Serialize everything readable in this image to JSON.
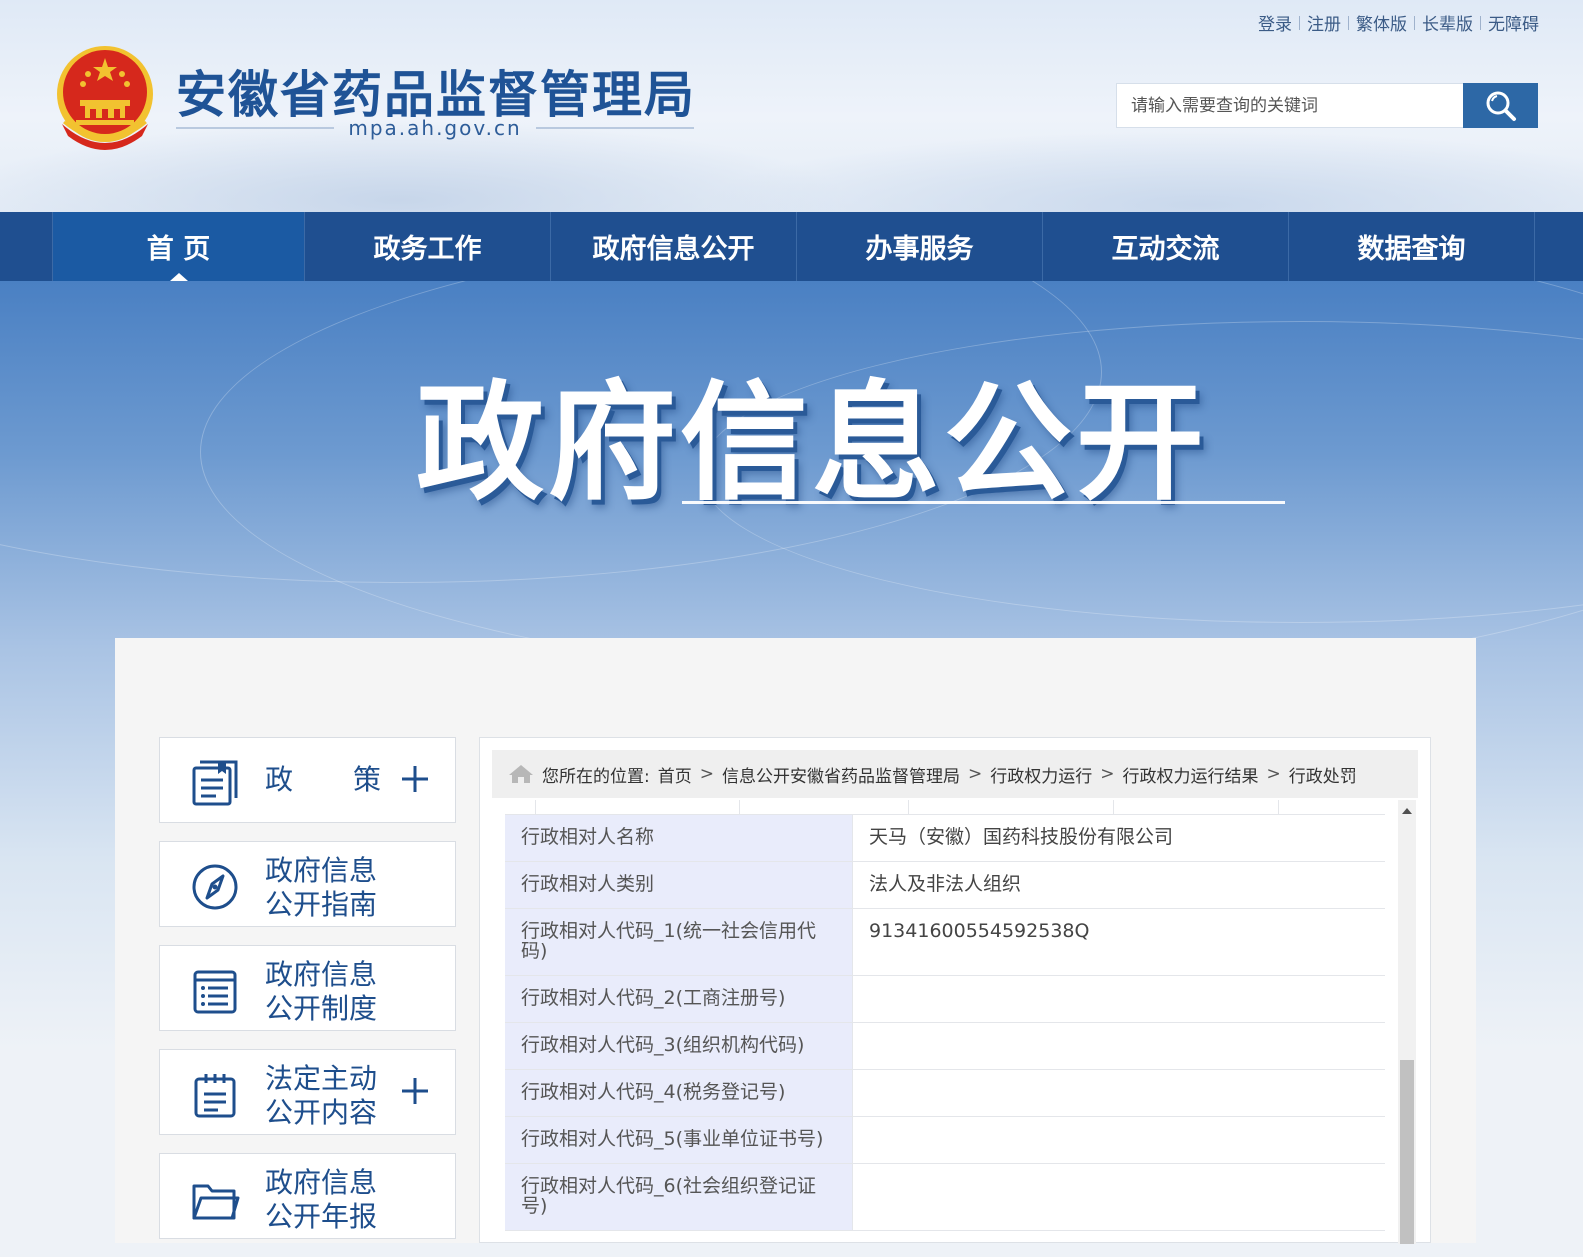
{
  "header": {
    "top_links": [
      "登录",
      "注册",
      "繁体版",
      "长辈版",
      "无障碍"
    ],
    "site_title": "安徽省药品监督管理局",
    "site_domain": "mpa.ah.gov.cn",
    "search": {
      "placeholder": "请输入需要查询的关键词"
    }
  },
  "nav": {
    "items": [
      "首 页",
      "政务工作",
      "政府信息公开",
      "办事服务",
      "互动交流",
      "数据查询"
    ],
    "active_index": 0
  },
  "banner": {
    "title": "政府信息公开"
  },
  "sidebar": {
    "items": [
      {
        "label_chars": [
          "政",
          "策"
        ],
        "icon": "document-stack-icon",
        "expandable": true
      },
      {
        "label": [
          "政府信息",
          "公开指南"
        ],
        "icon": "compass-icon",
        "expandable": false
      },
      {
        "label": [
          "政府信息",
          "公开制度"
        ],
        "icon": "list-doc-icon",
        "expandable": false
      },
      {
        "label": [
          "法定主动",
          "公开内容"
        ],
        "icon": "clipboard-icon",
        "expandable": true
      },
      {
        "label": [
          "政府信息",
          "公开年报"
        ],
        "icon": "folder-icon",
        "expandable": false
      }
    ]
  },
  "breadcrumb": {
    "prefix": "您所在的位置:",
    "items": [
      "首页",
      "信息公开安徽省药品监督管理局",
      "行政权力运行",
      "行政权力运行结果",
      "行政处罚"
    ]
  },
  "record": {
    "rows": [
      {
        "key": "行政相对人名称",
        "value": "天马（安徽）国药科技股份有限公司"
      },
      {
        "key": "行政相对人类别",
        "value": "法人及非法人组织"
      },
      {
        "key": "行政相对人代码_1(统一社会信用代码)",
        "value": "91341600554592538Q"
      },
      {
        "key": "行政相对人代码_2(工商注册号)",
        "value": ""
      },
      {
        "key": "行政相对人代码_3(组织机构代码)",
        "value": ""
      },
      {
        "key": "行政相对人代码_4(税务登记号)",
        "value": ""
      },
      {
        "key": "行政相对人代码_5(事业单位证书号)",
        "value": ""
      },
      {
        "key": "行政相对人代码_6(社会组织登记证号)",
        "value": ""
      }
    ]
  },
  "colors": {
    "brand_blue": "#1f4f90",
    "title_blue": "#1f5396",
    "emblem_red": "#d6281c",
    "emblem_gold": "#f2c230"
  }
}
